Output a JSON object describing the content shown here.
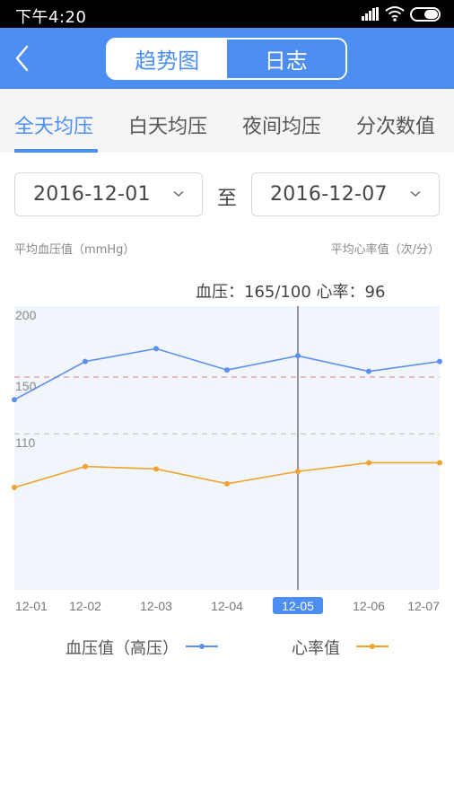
{
  "status_bar": {
    "time": "下午4:20",
    "icons": [
      "signal-icon",
      "wifi-icon",
      "battery-icon"
    ]
  },
  "header": {
    "back_icon": "chevron-left-icon",
    "segments": [
      {
        "label": "趋势图",
        "active": true
      },
      {
        "label": "日志",
        "active": false
      }
    ]
  },
  "tabs": [
    {
      "label": "全天均压",
      "active": true
    },
    {
      "label": "白天均压",
      "active": false
    },
    {
      "label": "夜间均压",
      "active": false
    },
    {
      "label": "分次数值",
      "active": false
    }
  ],
  "date_range": {
    "start": "2016-12-01",
    "separator": "至",
    "end": "2016-12-07"
  },
  "axis_titles": {
    "left": "平均血压值（mmHg）",
    "right": "平均心率值（次/分）"
  },
  "tooltip": {
    "text": "血压：165/100   心率：96"
  },
  "colors": {
    "accent": "#4c8ef1",
    "bp_line": "#5b90ee",
    "hr_line": "#f0a32f",
    "upper_ref": "#e59a9a",
    "lower_ref": "#a6d3b6",
    "plot_bg": "#f1f5fc"
  },
  "chart_data": {
    "type": "line",
    "title": "",
    "xlabel": "",
    "ylabel": "平均血压值（mmHg）",
    "y2label": "平均心率值（次/分）",
    "x": [
      "12-01",
      "12-02",
      "12-03",
      "12-04",
      "12-05",
      "12-06",
      "12-07"
    ],
    "selected_index": 4,
    "ylim": [
      0,
      200
    ],
    "y2lim": [
      0,
      230
    ],
    "yticks": [
      {
        "value": 200,
        "label": "200"
      },
      {
        "value": 150,
        "label": "150"
      },
      {
        "value": 110,
        "label": "110"
      }
    ],
    "reference_lines": [
      {
        "value": 150,
        "color": "#e59a9a",
        "style": "dashed"
      },
      {
        "value": 110,
        "color": "#a6d3b6",
        "style": "dashed"
      }
    ],
    "series": [
      {
        "name": "血压值（高压）",
        "axis": "left",
        "color": "#5b90ee",
        "values": [
          134,
          161,
          170,
          155,
          165,
          154,
          161
        ]
      },
      {
        "name": "心率值",
        "axis": "right",
        "color": "#f0a32f",
        "values": [
          83,
          100,
          98,
          86,
          96,
          103,
          103
        ]
      }
    ],
    "selected_point": {
      "x": "12-05",
      "systolic": 165,
      "diastolic": 100,
      "heart_rate": 96
    },
    "grid": false,
    "legend": "bottom"
  }
}
